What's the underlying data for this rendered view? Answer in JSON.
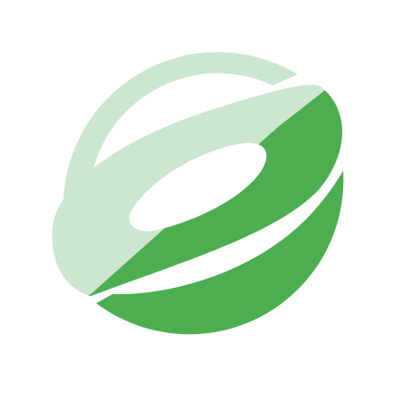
{
  "logo": {
    "icon_name": "green-orbit-logo-icon",
    "colors": {
      "background": "#ffffff",
      "light_green": "#cce6d0",
      "dark_green": "#4cae50"
    }
  }
}
